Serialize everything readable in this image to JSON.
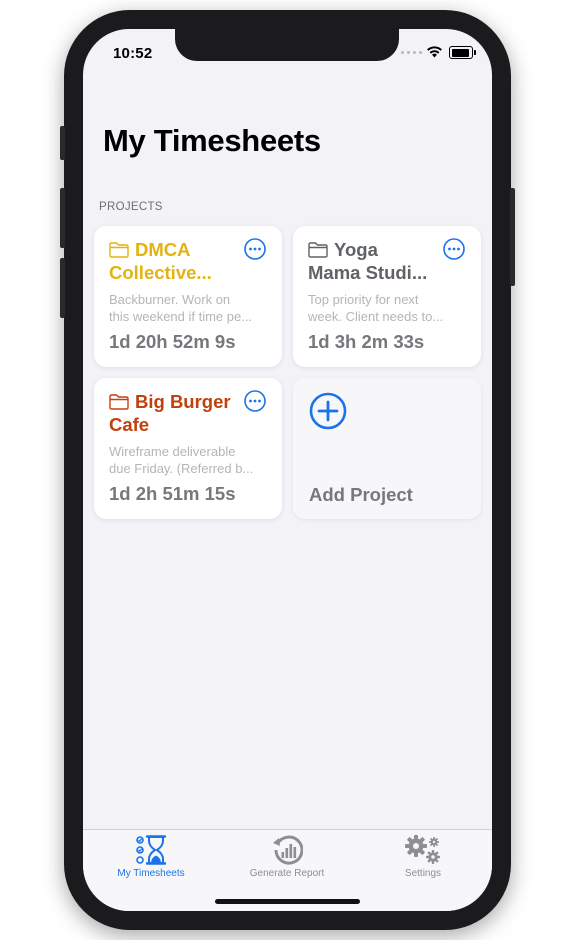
{
  "status_bar": {
    "time": "10:52"
  },
  "page_title": "My Timesheets",
  "section_header": "PROJECTS",
  "projects": [
    {
      "name_line1": "DMCA",
      "name_line2": "Collective...",
      "color": "#e3b30f",
      "desc_line1": "Backburner. Work on",
      "desc_line2": "this weekend if time pe...",
      "time": "1d 20h 52m 9s"
    },
    {
      "name_line1": "Yoga",
      "name_line2": "Mama Studi...",
      "color": "#5f6368",
      "desc_line1": "Top priority for next",
      "desc_line2": "week. Client needs to...",
      "time": "1d 3h 2m 33s"
    },
    {
      "name_line1": "Big Burger",
      "name_line2": "Cafe",
      "color": "#c1410c",
      "desc_line1": "Wireframe deliverable",
      "desc_line2": "due Friday. (Referred b...",
      "time": "1d 2h 51m 15s"
    }
  ],
  "add_project_label": "Add Project",
  "accent_color": "#1a73e8",
  "tabs": [
    {
      "label": "My Timesheets",
      "icon": "hourglass-checklist-icon",
      "active": true
    },
    {
      "label": "Generate Report",
      "icon": "report-history-icon",
      "active": false
    },
    {
      "label": "Settings",
      "icon": "gears-icon",
      "active": false
    }
  ]
}
